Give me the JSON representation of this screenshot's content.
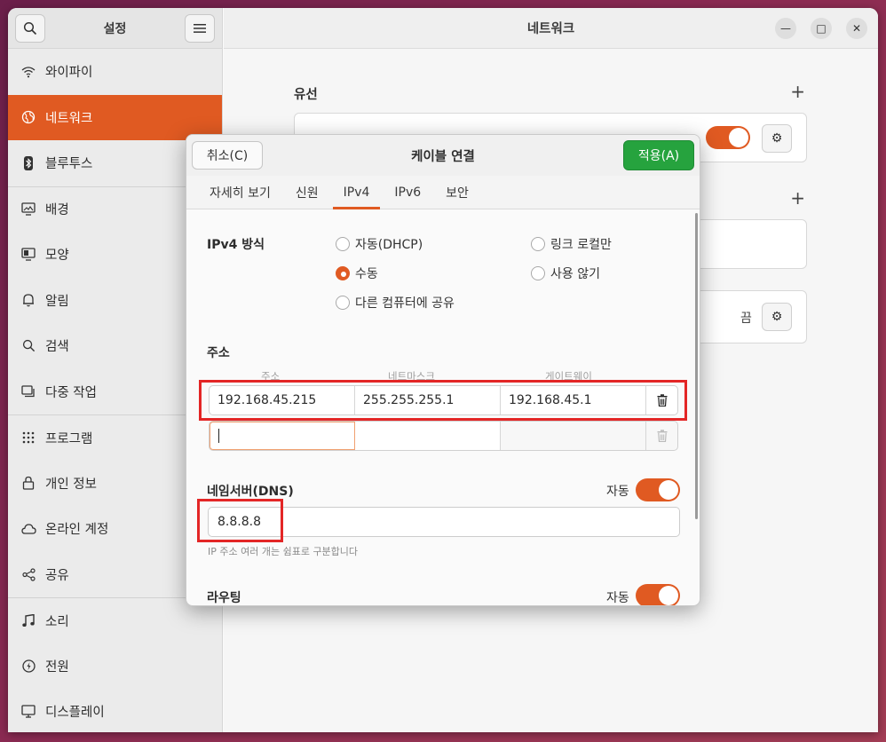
{
  "sidebar": {
    "title": "설정",
    "items": [
      {
        "label": "와이파이",
        "icon": "wifi-icon"
      },
      {
        "label": "네트워크",
        "icon": "network-icon",
        "active": true
      },
      {
        "label": "블루투스",
        "icon": "bluetooth-icon"
      },
      {
        "label": "배경",
        "icon": "background-icon"
      },
      {
        "label": "모양",
        "icon": "appearance-icon"
      },
      {
        "label": "알림",
        "icon": "bell-icon"
      },
      {
        "label": "검색",
        "icon": "search-icon"
      },
      {
        "label": "다중 작업",
        "icon": "multitasking-icon"
      },
      {
        "label": "프로그램",
        "icon": "apps-icon"
      },
      {
        "label": "개인 정보",
        "icon": "lock-icon"
      },
      {
        "label": "온라인 계정",
        "icon": "cloud-icon"
      },
      {
        "label": "공유",
        "icon": "share-icon"
      },
      {
        "label": "소리",
        "icon": "music-note-icon"
      },
      {
        "label": "전원",
        "icon": "power-icon"
      },
      {
        "label": "디스플레이",
        "icon": "display-icon"
      }
    ]
  },
  "main": {
    "title": "네트워크",
    "wired_label": "유선",
    "vpn_off_label": "끔"
  },
  "dialog": {
    "title": "케이블 연결",
    "cancel_label": "취소(C)",
    "apply_label": "적용(A)",
    "tabs": [
      "자세히 보기",
      "신원",
      "IPv4",
      "IPv6",
      "보안"
    ],
    "active_tab": "IPv4",
    "ipv4_method_label": "IPv4 방식",
    "methods": {
      "auto": "자동(DHCP)",
      "link_local": "링크 로컬만",
      "manual": "수동",
      "disabled": "사용 않기",
      "shared": "다른 컴퓨터에 공유"
    },
    "selected_method": "수동",
    "address_label": "주소",
    "columns": {
      "address": "주소",
      "netmask": "네트마스크",
      "gateway": "게이트웨이"
    },
    "address_rows": [
      {
        "address": "192.168.45.215",
        "netmask": "255.255.255.1",
        "gateway": "192.168.45.1"
      },
      {
        "address": "",
        "netmask": "",
        "gateway": ""
      }
    ],
    "dns_label": "네임서버(DNS)",
    "dns_auto_label": "자동",
    "dns_value": "8.8.8.8",
    "dns_hint": "IP 주소 여러 개는 쉼표로 구분합니다",
    "routing_label": "라우팅",
    "routing_auto_label": "자동"
  },
  "colors": {
    "accent": "#e05a22",
    "apply": "#26a33e",
    "highlight": "#e32626"
  }
}
